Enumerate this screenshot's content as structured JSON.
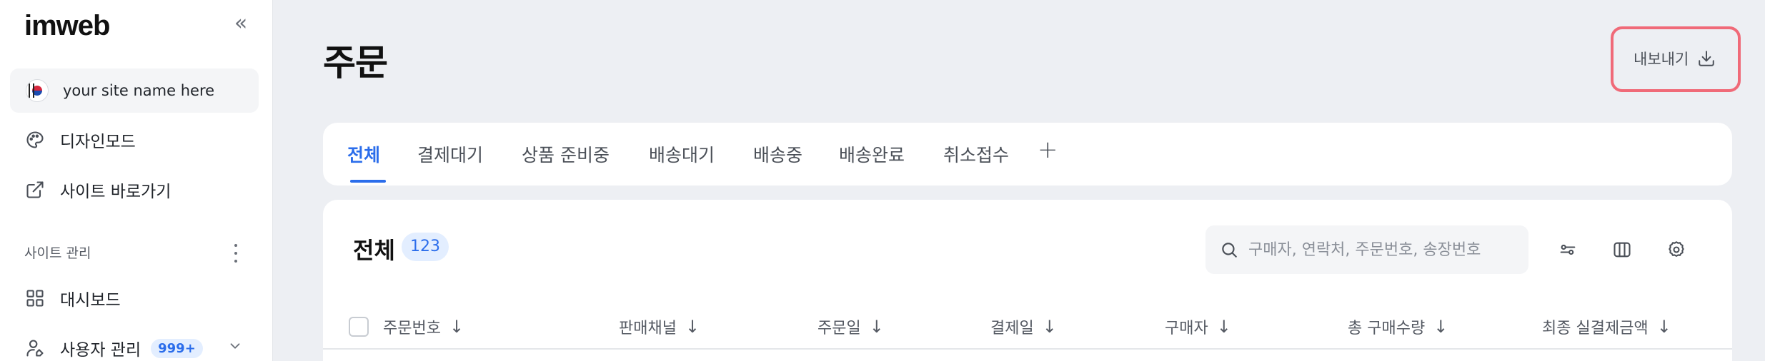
{
  "sidebar": {
    "logo": "imweb",
    "collapse_icon": "chevrons-left-icon",
    "site_name": "your site name here",
    "items": [
      {
        "label": "디자인모드",
        "icon": "palette-icon"
      },
      {
        "label": "사이트 바로가기",
        "icon": "external-link-icon"
      }
    ],
    "section_label": "사이트 관리",
    "section_items": [
      {
        "label": "대시보드",
        "icon": "grid-icon"
      },
      {
        "label": "사용자 관리",
        "icon": "user-edit-icon",
        "badge": "999+"
      }
    ]
  },
  "header": {
    "title": "주문",
    "export_label": "내보내기",
    "export_icon": "download-icon"
  },
  "tabs": [
    {
      "label": "전체",
      "active": true
    },
    {
      "label": "결제대기"
    },
    {
      "label": "상품 준비중"
    },
    {
      "label": "배송대기"
    },
    {
      "label": "배송중"
    },
    {
      "label": "배송완료"
    },
    {
      "label": "취소접수"
    }
  ],
  "tab_add_label": "+",
  "list": {
    "title": "전체",
    "count": "123",
    "search_placeholder": "구매자, 연락처, 주문번호, 송장번호",
    "toolbar_icons": [
      "filter-icon",
      "columns-icon",
      "settings-icon"
    ],
    "columns": [
      "주문번호",
      "판매채널",
      "주문일",
      "결제일",
      "구매자",
      "총 구매수량",
      "최종 실결제금액"
    ],
    "sort_arrow": "↓"
  },
  "colors": {
    "accent": "#2B6DEB",
    "highlight_border": "#F06A78",
    "background": "#EDEFF3"
  }
}
